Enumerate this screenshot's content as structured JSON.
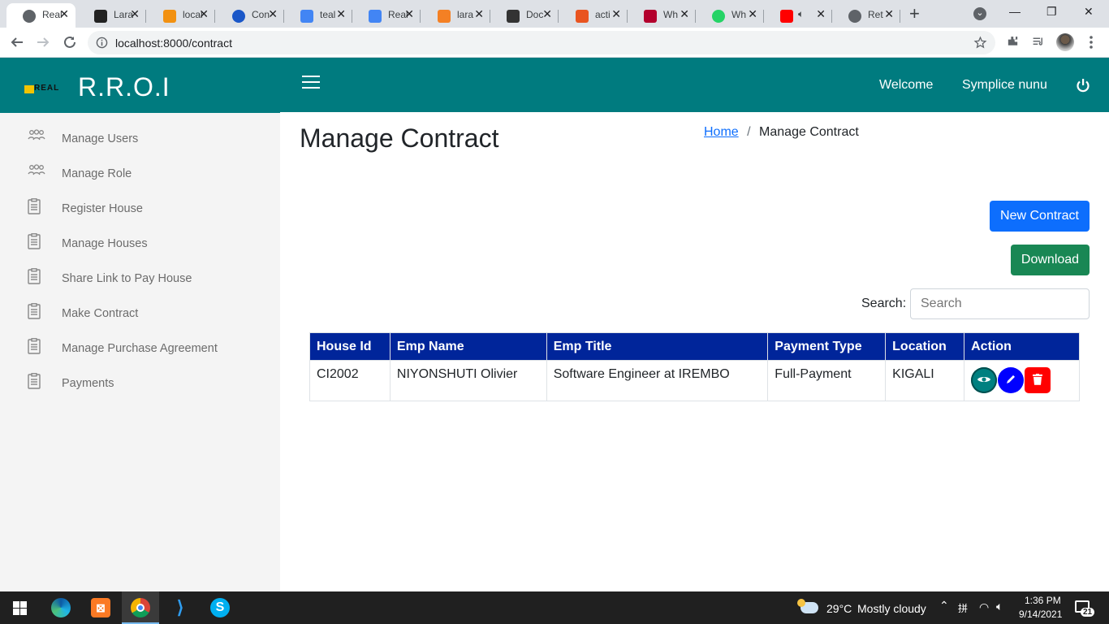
{
  "browser": {
    "tabs": [
      {
        "title": "Real",
        "favicon": "globe-icon",
        "color": "#5f6368",
        "active": true
      },
      {
        "title": "Lara",
        "favicon": "ns-icon",
        "color": "#222222"
      },
      {
        "title": "local",
        "favicon": "phpmyadmin-icon",
        "color": "#f29111"
      },
      {
        "title": "Con",
        "favicon": "circle-icon",
        "color": "#1a57c8"
      },
      {
        "title": "teal",
        "favicon": "google-icon",
        "color": "#4285f4"
      },
      {
        "title": "Real",
        "favicon": "docs-icon",
        "color": "#4285f4"
      },
      {
        "title": "lara",
        "favicon": "stackoverflow-icon",
        "color": "#f48024"
      },
      {
        "title": "Doc",
        "favicon": "laravel-icon",
        "color": "#333333"
      },
      {
        "title": "acti",
        "favicon": "ubuntu-icon",
        "color": "#e95420"
      },
      {
        "title": "Wh",
        "favicon": "d-icon",
        "color": "#b3002d"
      },
      {
        "title": "Wh",
        "favicon": "whatsapp-icon",
        "color": "#25d366"
      },
      {
        "title": "",
        "favicon": "youtube-icon",
        "color": "#ff0000",
        "audio": true
      },
      {
        "title": "Ret",
        "favicon": "edge-icon",
        "color": "#5f6368"
      }
    ],
    "new_tab": "+",
    "url": "localhost:8000/contract"
  },
  "app": {
    "brand": "R.R.O.I",
    "logo_text": "REAL",
    "welcome": "Welcome",
    "user": "Symplice nunu",
    "sidebar": [
      {
        "label": "Manage Users",
        "icon": "users-icon"
      },
      {
        "label": "Manage Role",
        "icon": "users-icon"
      },
      {
        "label": "Register House",
        "icon": "clipboard-icon"
      },
      {
        "label": "Manage Houses",
        "icon": "clipboard-icon"
      },
      {
        "label": "Share Link to Pay House",
        "icon": "clipboard-icon"
      },
      {
        "label": "Make Contract",
        "icon": "clipboard-icon"
      },
      {
        "label": "Manage Purchase Agreement",
        "icon": "clipboard-icon"
      },
      {
        "label": "Payments",
        "icon": "clipboard-icon"
      }
    ],
    "page_title": "Manage Contract",
    "breadcrumb": {
      "home": "Home",
      "sep": "/",
      "current": "Manage Contract"
    },
    "new_contract_label": "New Contract",
    "download_label": "Download",
    "search_label": "Search:",
    "search_placeholder": "Search",
    "table": {
      "headers": [
        "House Id",
        "Emp Name",
        "Emp Title",
        "Payment Type",
        "Location",
        "Action"
      ],
      "rows": [
        [
          "CI2002",
          "NIYONSHUTI Olivier",
          "Software Engineer at IREMBO",
          "Full-Payment",
          "KIGALI"
        ]
      ]
    },
    "colors": {
      "primary": "#007b7f",
      "table_header": "#00259a",
      "new_btn": "#0d6efd",
      "download_btn": "#198754",
      "view_btn": "#008080",
      "edit_btn": "#0000ff",
      "delete_btn": "#ff0000"
    }
  },
  "taskbar": {
    "apps": [
      "windows-start-icon",
      "edge-icon",
      "xampp-icon",
      "chrome-icon",
      "vscode-icon",
      "skype-icon"
    ],
    "weather_temp": "29°C",
    "weather_desc": "Mostly cloudy",
    "time": "1:36 PM",
    "date": "9/14/2021",
    "notifications": "21"
  }
}
